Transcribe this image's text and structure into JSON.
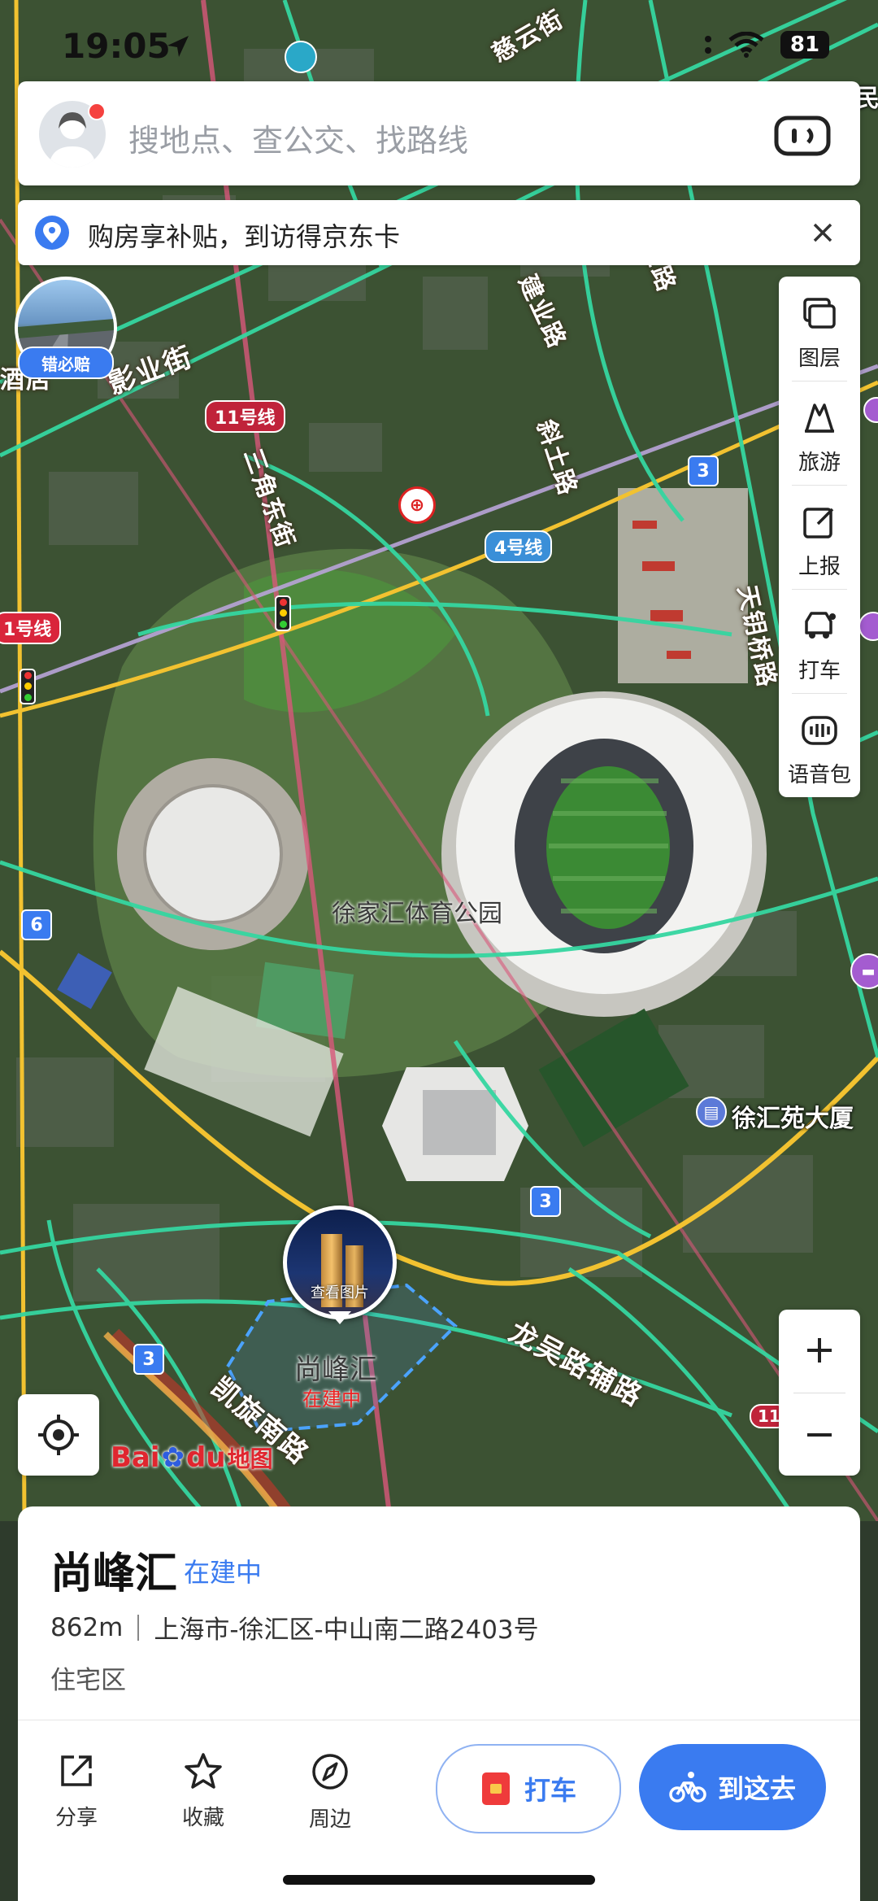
{
  "status_bar": {
    "time": "19:05",
    "battery": "81"
  },
  "search": {
    "placeholder": "搜地点、查公交、找路线"
  },
  "banner": {
    "text": "购房享补贴，到访得京东卡"
  },
  "travel_tag": "错必赔",
  "toolbar": {
    "items": [
      {
        "label": "图层",
        "icon": "layers-icon"
      },
      {
        "label": "旅游",
        "icon": "travel-icon"
      },
      {
        "label": "上报",
        "icon": "report-icon"
      },
      {
        "label": "打车",
        "icon": "taxi-icon"
      },
      {
        "label": "语音包",
        "icon": "voice-pack-icon"
      }
    ]
  },
  "map": {
    "labels": {
      "hotel_partial": "酒店",
      "yingye": "影业街",
      "sanjiao": "三角东街",
      "jianye": "建业路",
      "xietu": "斜土路",
      "tianyao": "天钥桥路",
      "park": "徐家汇体育公园",
      "xuhuiyuan": "徐汇苑大厦",
      "longwu": "龙吴路辅路",
      "kaixuan": "凯旋南路",
      "shangfenghui": "尚峰汇",
      "under_construction": "在建中",
      "photo_caption": "查看图片",
      "cisui": "慈云街",
      "edge_right": "民"
    },
    "metro": [
      {
        "label": "11号线",
        "color": "#c0233a"
      },
      {
        "label": "4号线",
        "color": "#3a8fd8"
      },
      {
        "label": "1号线",
        "color": "#d9253b"
      },
      {
        "label": "11",
        "color": "#c0233a"
      }
    ],
    "route_badges": [
      "3",
      "3",
      "3",
      "6"
    ]
  },
  "logo": {
    "text": "Baidu",
    "suffix": "地图"
  },
  "sheet": {
    "title": "尚峰汇",
    "status": "在建中",
    "distance": "862m",
    "address": "上海市-徐汇区-中山南二路2403号",
    "type": "住宅区",
    "actions": [
      {
        "label": "分享",
        "icon": "share-icon"
      },
      {
        "label": "收藏",
        "icon": "star-icon"
      },
      {
        "label": "周边",
        "icon": "compass-icon"
      }
    ],
    "taxi_button": "打车",
    "go_button": "到这去"
  },
  "colors": {
    "accent": "#3a7bf0",
    "road_green": "#35d6a0",
    "road_yellow": "#f2c230"
  }
}
